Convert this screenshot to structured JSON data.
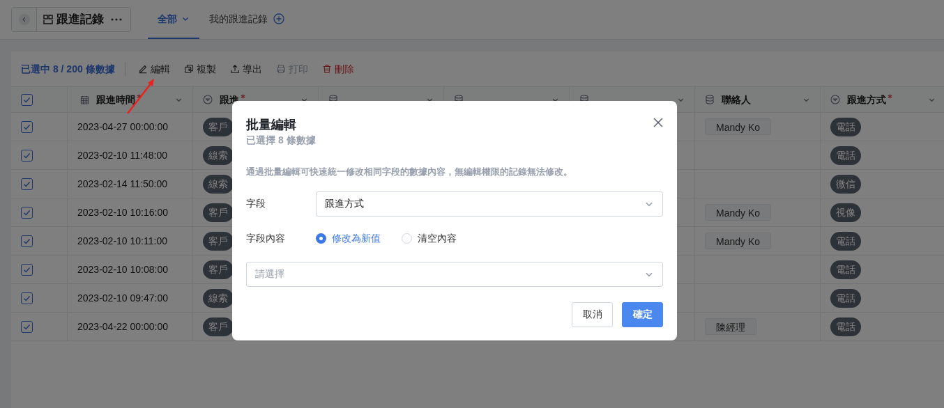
{
  "app": {
    "title": "跟進記錄"
  },
  "tabs": [
    {
      "label": "全部",
      "selected": true,
      "kind": "dropdown"
    },
    {
      "label": "我的跟進記錄",
      "selected": false,
      "kind": "add"
    }
  ],
  "toolbar": {
    "selection": "已選中 8 / 200 條數據",
    "actions": [
      {
        "label": "編輯",
        "kind": "edit",
        "disabled": false
      },
      {
        "label": "複製",
        "kind": "copy",
        "disabled": false
      },
      {
        "label": "導出",
        "kind": "export",
        "disabled": false
      },
      {
        "label": "打印",
        "kind": "print",
        "disabled": true
      },
      {
        "label": "刪除",
        "kind": "delete",
        "disabled": false
      }
    ]
  },
  "table": {
    "all_checked": true,
    "columns": [
      {
        "label": "跟進時間",
        "kind": "date",
        "required": true
      },
      {
        "label": "跟進",
        "kind": "select",
        "required": true
      },
      {
        "kind": "relation",
        "required": false
      },
      {
        "kind": "relation",
        "required": false
      },
      {
        "kind": "relation",
        "required": false
      },
      {
        "label": "聯絡人",
        "kind": "relation",
        "required": false
      },
      {
        "label": "跟進方式",
        "kind": "select",
        "required": true
      }
    ],
    "rows": [
      {
        "checked": true,
        "time": "2023-04-27 00:00:00",
        "subject": "客戶",
        "contact": "Mandy Ko",
        "method": "電話"
      },
      {
        "checked": true,
        "time": "2023-02-10 11:48:00",
        "subject": "線索",
        "method": "電話"
      },
      {
        "checked": true,
        "time": "2023-02-14 11:50:00",
        "subject": "線索",
        "method": "微信"
      },
      {
        "checked": true,
        "time": "2023-02-10 10:16:00",
        "subject": "客戶",
        "contact": "Mandy Ko",
        "method": "視像"
      },
      {
        "checked": true,
        "time": "2023-02-10 10:11:00",
        "subject": "客戶",
        "contact": "Mandy Ko",
        "method": "電話"
      },
      {
        "checked": true,
        "time": "2023-02-10 10:08:00",
        "subject": "客戶",
        "method": "電話"
      },
      {
        "checked": true,
        "time": "2023-02-10 09:47:00",
        "subject": "線索",
        "method": "電話"
      },
      {
        "checked": true,
        "time": "2023-04-22 00:00:00",
        "subject": "客戶",
        "contact": "陳經理",
        "method": "電話"
      }
    ]
  },
  "dialog": {
    "title": "批量編輯",
    "subtitle": "已選擇 8 條數據",
    "note": "通過批量編輯可快速統一修改相同字段的數據內容，無編輯權限的記錄無法修改。",
    "field": {
      "label": "字段",
      "value": "跟進方式"
    },
    "content": {
      "label": "字段內容",
      "options": [
        {
          "label": "修改為新值",
          "selected": true
        },
        {
          "label": "清空內容",
          "selected": false
        }
      ]
    },
    "value_select": {
      "placeholder": "請選擇"
    },
    "buttons": [
      {
        "label": "取消",
        "kind": "secondary"
      },
      {
        "label": "確定",
        "kind": "primary"
      }
    ]
  }
}
